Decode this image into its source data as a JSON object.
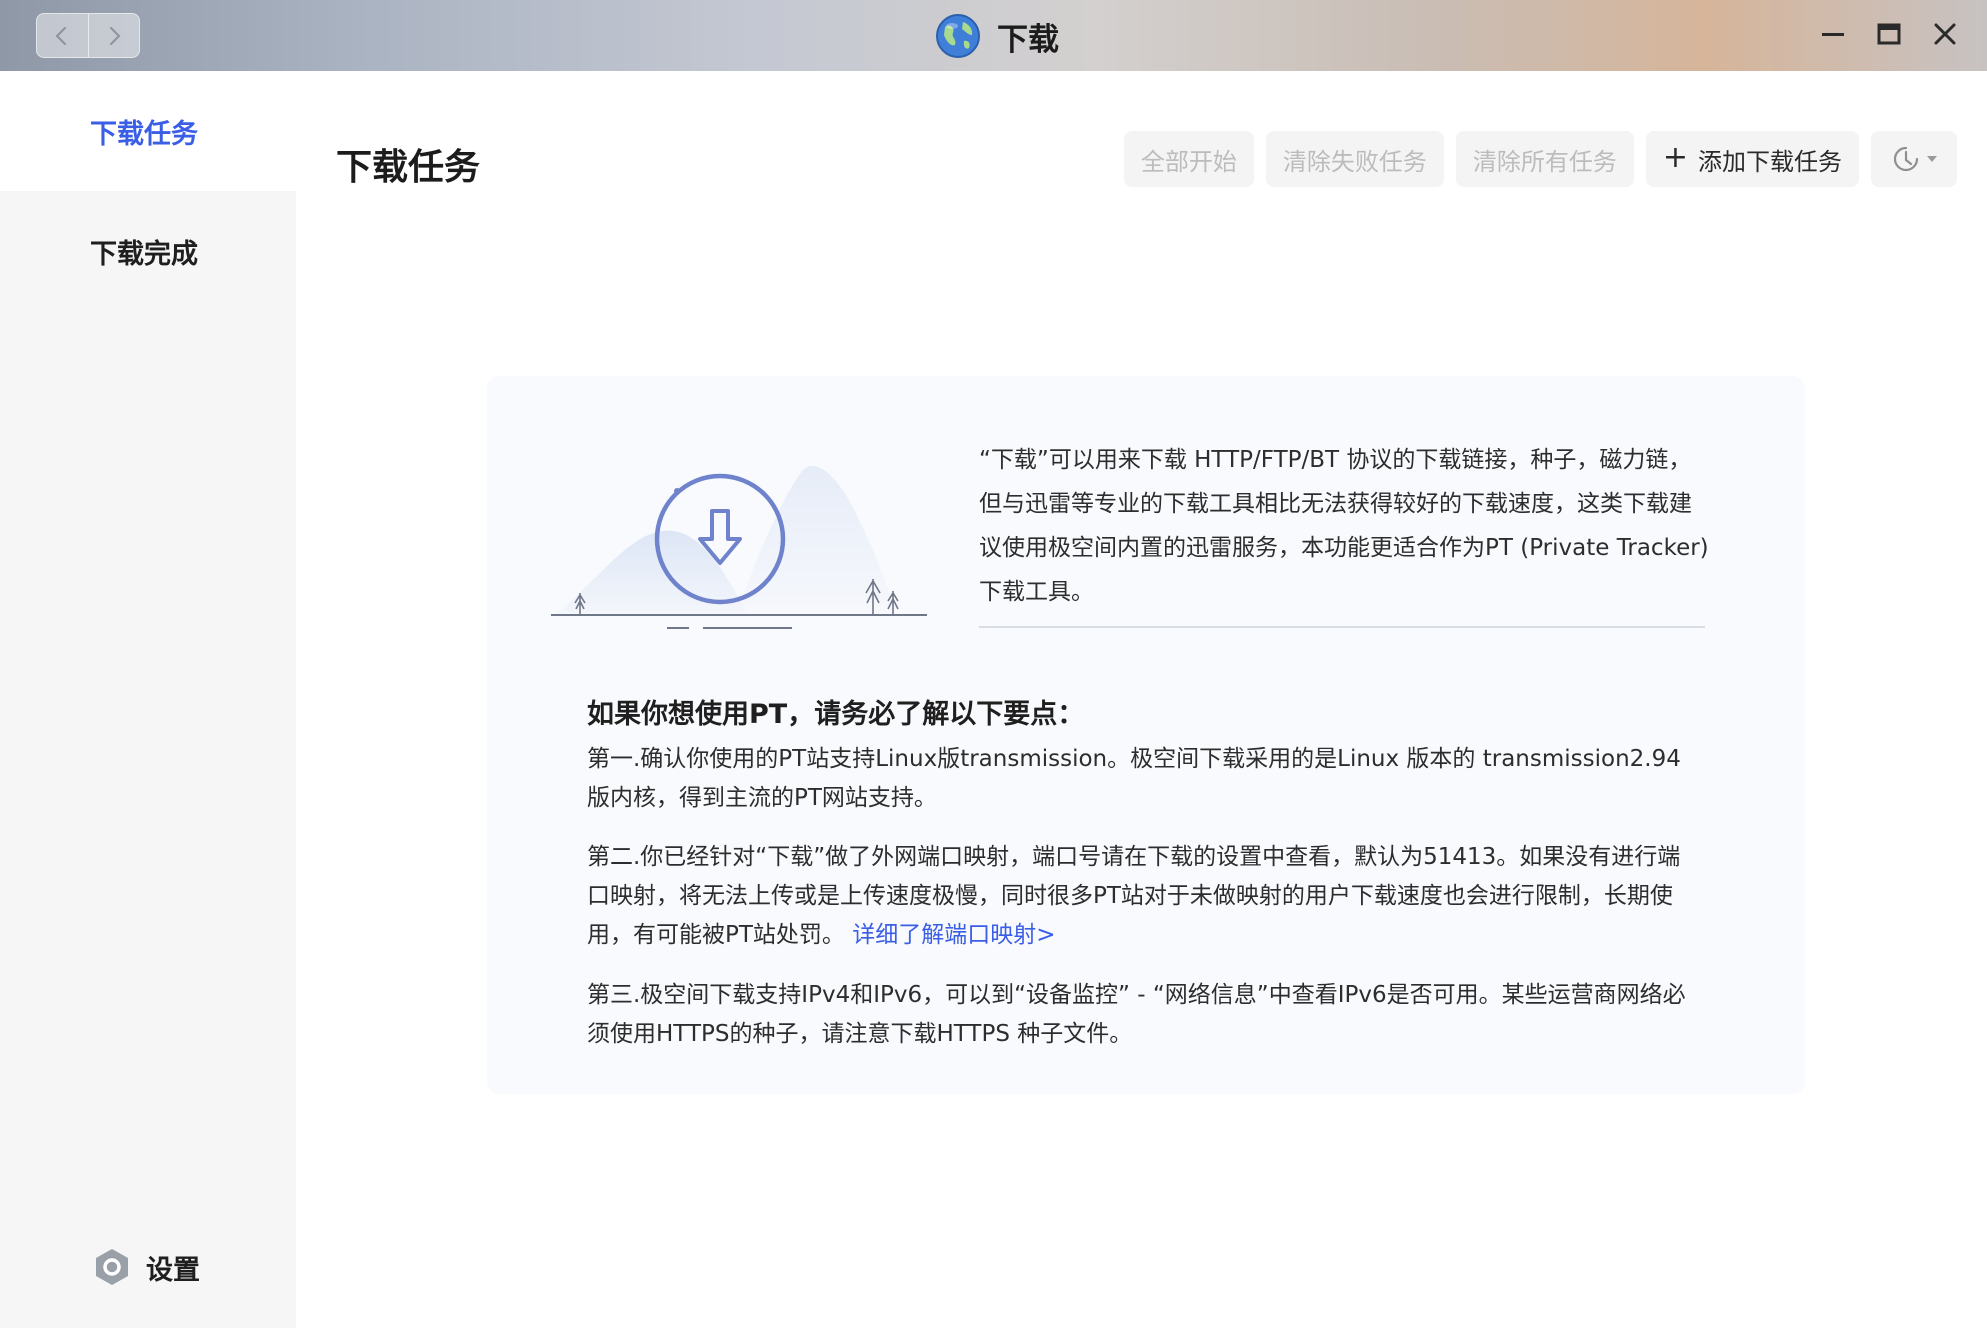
{
  "window": {
    "title": "下载",
    "back_icon": "chevron-left-icon",
    "forward_icon": "chevron-right-icon",
    "controls": [
      "minimize-icon",
      "maximize-icon",
      "close-icon"
    ]
  },
  "sidebar": {
    "items": [
      {
        "label": "下载任务",
        "active": true
      },
      {
        "label": "下载完成",
        "active": false
      }
    ],
    "settings_label": "设置",
    "accent": "#3a5ee6"
  },
  "header": {
    "title": "下载任务",
    "buttons": {
      "start_all": "全部开始",
      "clear_failed": "清除失败任务",
      "clear_all": "清除所有任务",
      "add_task": "添加下载任务"
    },
    "menu_icon": "speed-gauge-icon"
  },
  "info": {
    "intro": "“下载”可以用来下载 HTTP/FTP/BT 协议的下载链接，种子，磁力链，但与迅雷等专业的下载工具相比无法获得较好的下载速度，这类下载建议使用极空间内置的迅雷服务，本功能更适合作为PT (Private Tracker) 下载工具。",
    "notice_title": "如果你想使用PT，请务必了解以下要点：",
    "point1": "第一.确认你使用的PT站支持Linux版transmission。极空间下载采用的是Linux 版本的 transmission2.94版内核，得到主流的PT网站支持。",
    "point2": "第二.你已经针对“下载”做了外网端口映射，端口号请在下载的设置中查看，默认为51413。如果没有进行端口映射，将无法上传或是上传速度极慢，同时很多PT站对于未做映射的用户下载速度也会进行限制，长期使用，有可能被PT站处罚。",
    "point2_link": "详细了解端口映射>",
    "point3": "第三.极空间下载支持IPv4和IPv6，可以到“设备监控” - “网络信息”中查看IPv6是否可用。某些运营商网络必须使用HTTPS的种子，请注意下载HTTPS 种子文件。"
  }
}
